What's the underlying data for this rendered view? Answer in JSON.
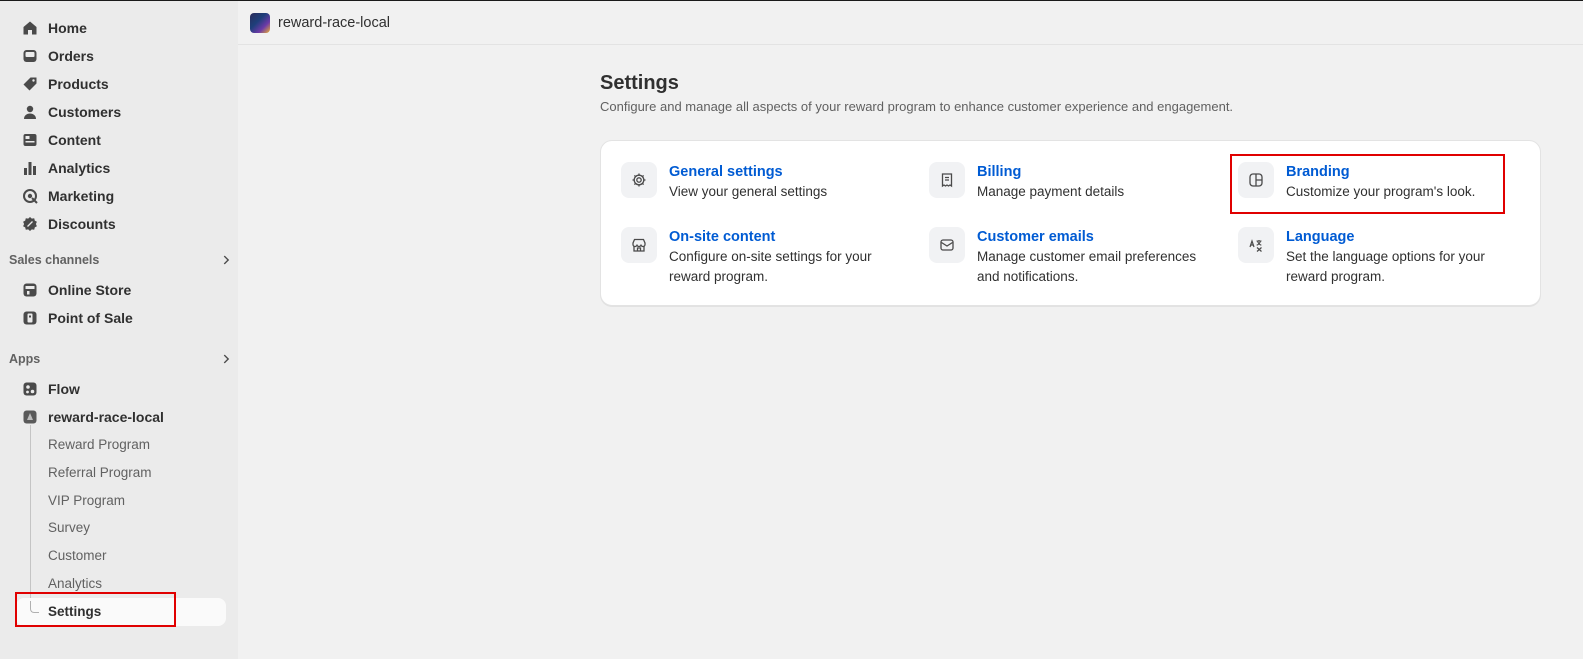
{
  "sidebar": {
    "main_items": [
      {
        "label": "Home",
        "icon": "home-icon"
      },
      {
        "label": "Orders",
        "icon": "inbox-icon"
      },
      {
        "label": "Products",
        "icon": "tag-icon"
      },
      {
        "label": "Customers",
        "icon": "person-icon"
      },
      {
        "label": "Content",
        "icon": "content-icon"
      },
      {
        "label": "Analytics",
        "icon": "bar-chart-icon"
      },
      {
        "label": "Marketing",
        "icon": "target-icon"
      },
      {
        "label": "Discounts",
        "icon": "discount-icon"
      }
    ],
    "sales_channels_label": "Sales channels",
    "sales_channels": [
      {
        "label": "Online Store",
        "icon": "store-icon"
      },
      {
        "label": "Point of Sale",
        "icon": "pos-icon"
      }
    ],
    "apps_label": "Apps",
    "apps": [
      {
        "label": "Flow",
        "icon": "flow-icon"
      },
      {
        "label": "reward-race-local",
        "icon": "app-icon"
      }
    ],
    "app_sub_items": [
      "Reward Program",
      "Referral Program",
      "VIP Program",
      "Survey",
      "Customer",
      "Analytics",
      "Settings"
    ]
  },
  "topbar": {
    "app_title": "reward-race-local"
  },
  "page": {
    "title": "Settings",
    "subtitle": "Configure and manage all aspects of your reward program to enhance customer experience and engagement."
  },
  "tiles": [
    {
      "title": "General settings",
      "desc": "View your general settings",
      "icon": "gear-icon"
    },
    {
      "title": "Billing",
      "desc": "Manage payment details",
      "icon": "receipt-icon"
    },
    {
      "title": "Branding",
      "desc": "Customize your program's look.",
      "icon": "layout-icon"
    },
    {
      "title": "On-site content",
      "desc": "Configure on-site settings for your reward program.",
      "icon": "store-icon"
    },
    {
      "title": "Customer emails",
      "desc": "Manage customer email preferences and notifications.",
      "icon": "email-icon"
    },
    {
      "title": "Language",
      "desc": "Set the language options for your reward program.",
      "icon": "language-icon"
    }
  ],
  "colors": {
    "link": "#005bd3",
    "highlight": "#e00000",
    "sidebar_bg": "#ebebeb",
    "page_bg": "#f1f1f1"
  }
}
